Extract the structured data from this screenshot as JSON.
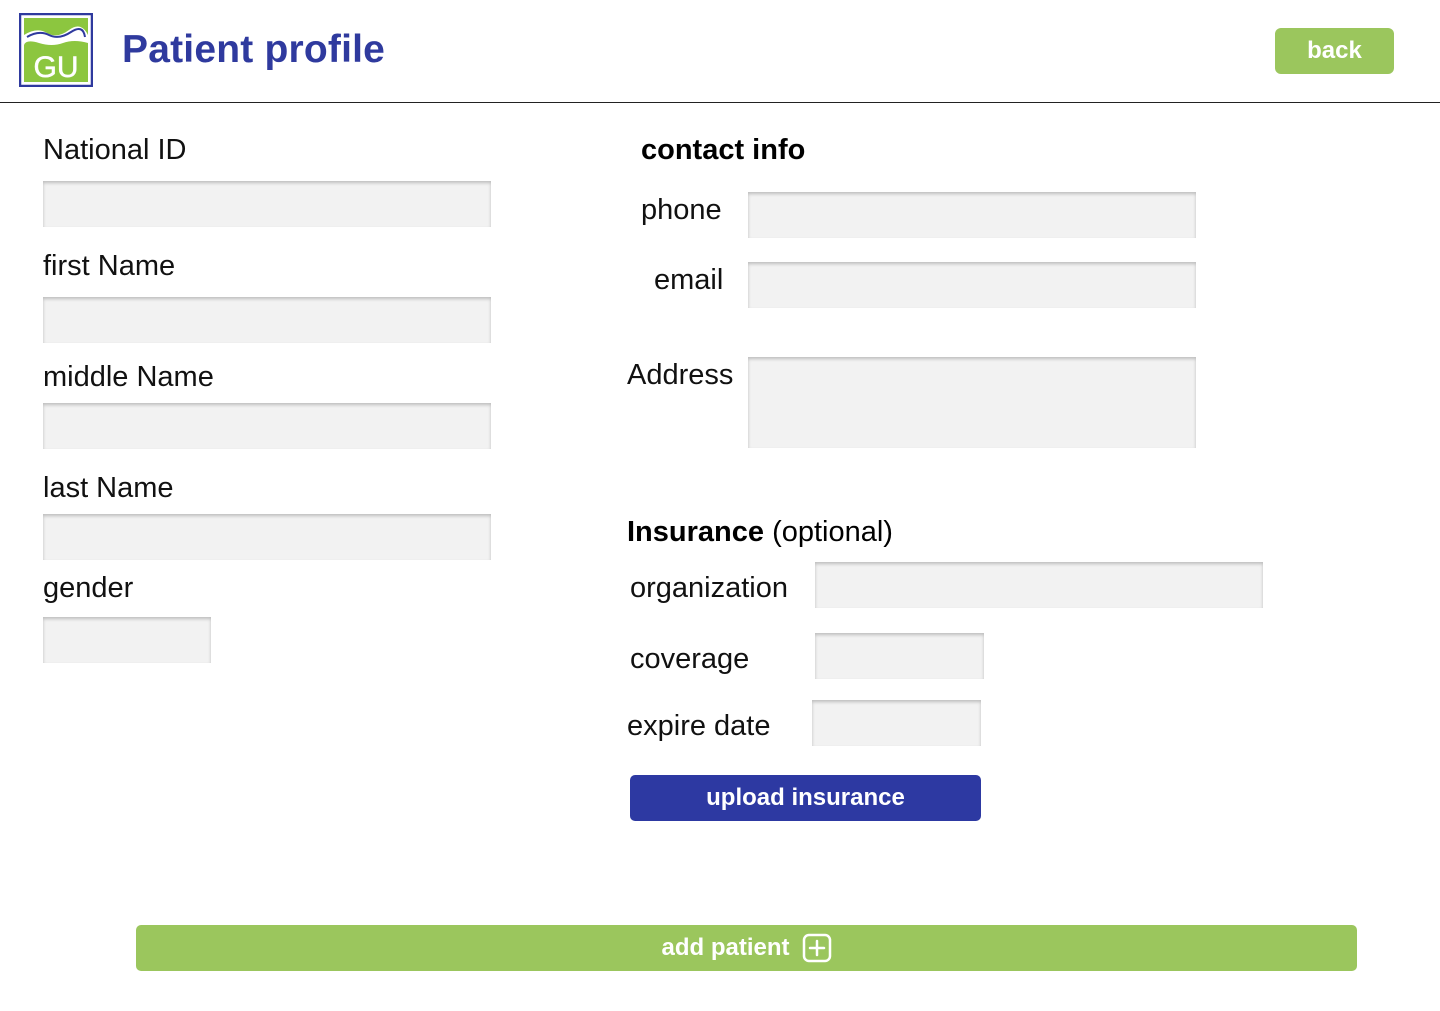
{
  "header": {
    "logo_text": "GU",
    "title": "Patient profile",
    "back_label": "back"
  },
  "personal": {
    "national_id_label": "National ID",
    "national_id_value": "",
    "first_name_label": "first Name",
    "first_name_value": "",
    "middle_name_label": "middle Name",
    "middle_name_value": "",
    "last_name_label": "last Name",
    "last_name_value": "",
    "gender_label": "gender",
    "gender_value": ""
  },
  "contact": {
    "title": "contact info",
    "phone_label": "phone",
    "phone_value": "",
    "email_label": "email",
    "email_value": "",
    "address_label": "Address",
    "address_value": ""
  },
  "insurance": {
    "title": "Insurance",
    "title_suffix": "(optional)",
    "organization_label": "organization",
    "organization_value": "",
    "coverage_label": "coverage",
    "coverage_value": "",
    "expire_date_label": "expire date",
    "expire_date_value": "",
    "upload_label": "upload insurance"
  },
  "footer": {
    "add_label": "add patient",
    "add_icon": "plus-square-icon"
  },
  "colors": {
    "title_blue": "#2f3a9e",
    "button_green": "#9bc65d",
    "button_blue": "#2d39a2",
    "field_bg": "#f2f2f2"
  }
}
